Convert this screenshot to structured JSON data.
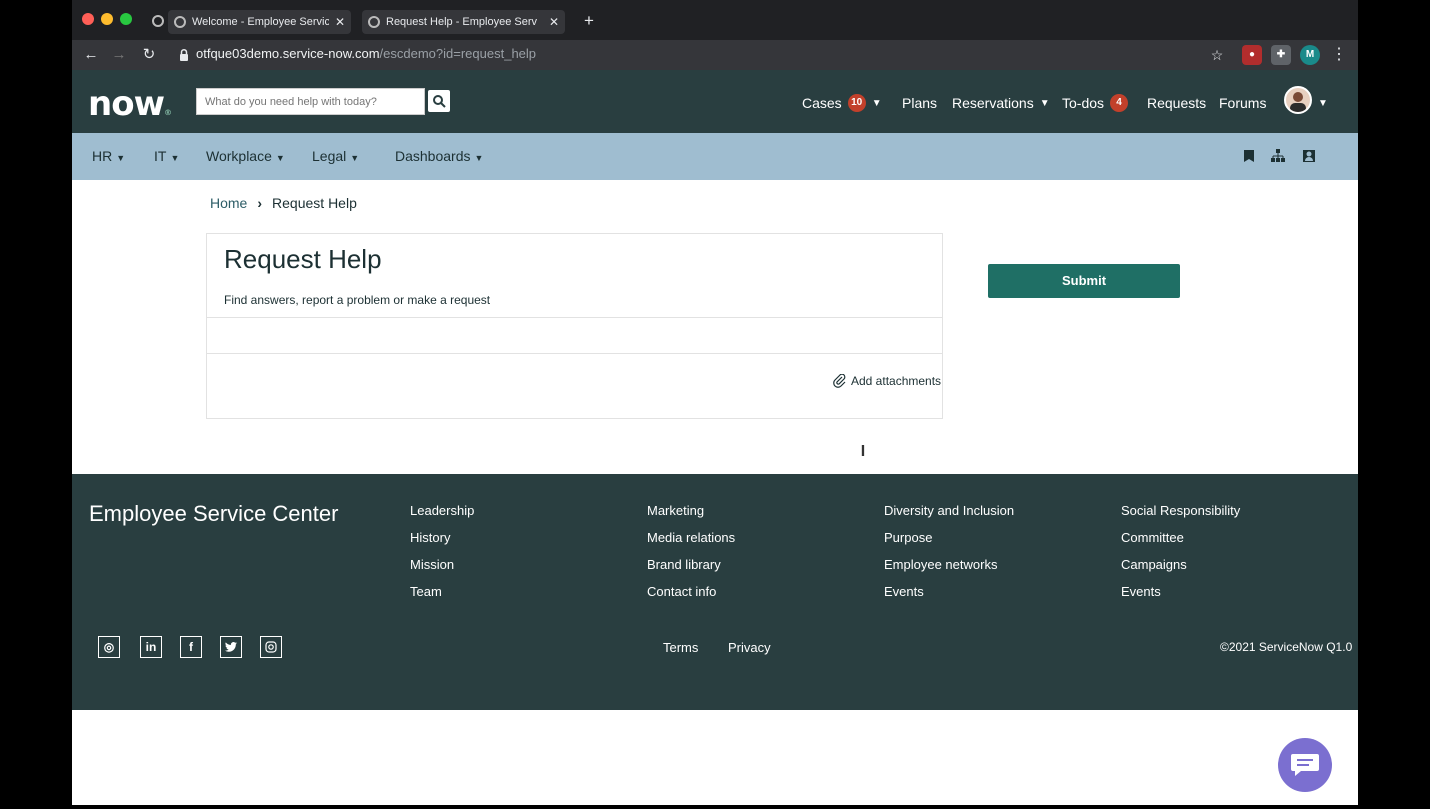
{
  "colors": {
    "header_bg": "#293e40",
    "menubar_bg": "#9fbdd0",
    "submit_bg": "#1f6f65",
    "badge": "#c2402b",
    "chat_bg": "#7b6fd0"
  },
  "browser": {
    "tabs": [
      {
        "title": "Welcome - Employee Service C",
        "active": false
      },
      {
        "title": "Request Help - Employee Serv",
        "active": true
      }
    ],
    "url_host": "otfque03demo.service-now.com",
    "url_path": "/escdemo?id=request_help",
    "extensions": [
      "ublock-icon",
      "puzzle-icon",
      "profile-M"
    ],
    "profile_initial": "M"
  },
  "header": {
    "logo_text": "now",
    "search_placeholder": "What do you need help with today?",
    "nav": {
      "cases": "Cases",
      "cases_count": "10",
      "plans": "Plans",
      "reservations": "Reservations",
      "todos": "To-dos",
      "todos_count": "4",
      "requests": "Requests",
      "forums": "Forums"
    }
  },
  "menu": {
    "items": [
      "HR",
      "IT",
      "Workplace",
      "Legal",
      "Dashboards"
    ]
  },
  "breadcrumb": {
    "home": "Home",
    "current": "Request Help"
  },
  "form": {
    "title": "Request Help",
    "subtitle": "Find answers, report a problem or make a request",
    "attach_label": "Add attachments",
    "submit_label": "Submit"
  },
  "footer": {
    "brand": "Employee Service Center",
    "columns": [
      [
        "Leadership",
        "History",
        "Mission",
        "Team"
      ],
      [
        "Marketing",
        "Media relations",
        "Brand library",
        "Contact info"
      ],
      [
        "Diversity and Inclusion",
        "Purpose",
        "Employee networks",
        "Events"
      ],
      [
        "Social Responsibility",
        "Committee",
        "Campaigns",
        "Events"
      ]
    ],
    "social": [
      "now",
      "in",
      "f",
      "tw",
      "ig"
    ],
    "terms": "Terms",
    "privacy": "Privacy",
    "copyright": "©2021 ServiceNow Q1.0"
  }
}
